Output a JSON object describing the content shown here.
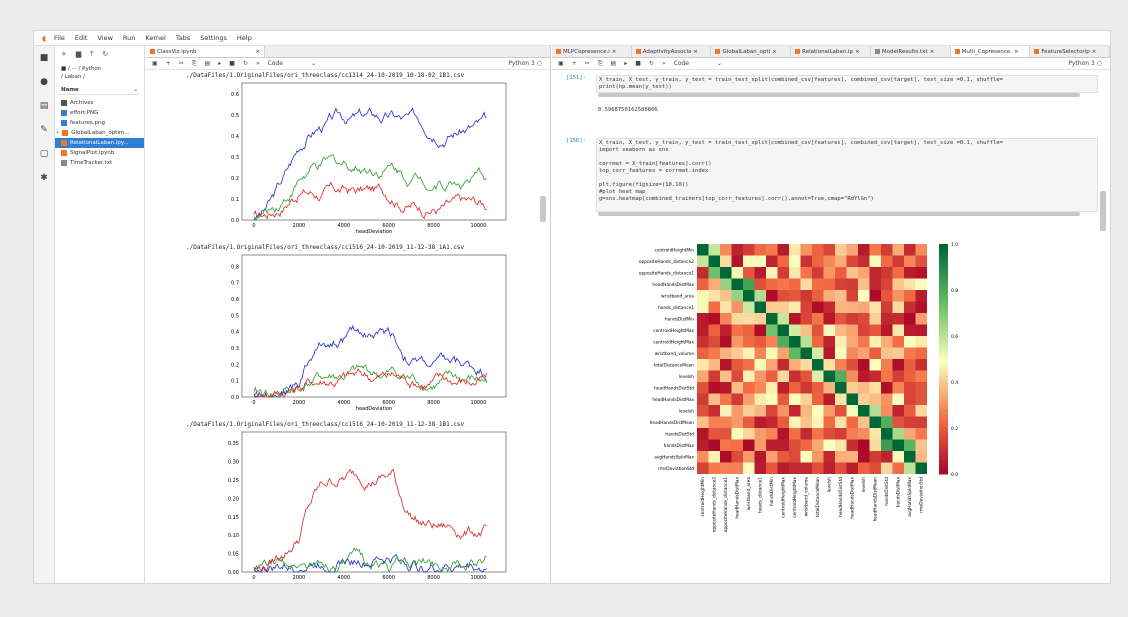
{
  "menu": [
    "File",
    "Edit",
    "View",
    "Run",
    "Kernel",
    "Tabs",
    "Settings",
    "Help"
  ],
  "filebrowser": {
    "path_line1": "■ / ··· / Python",
    "path_line2": "/ Laban /",
    "header_name": "Name",
    "items": [
      {
        "name": "Archives",
        "type": "folder"
      },
      {
        "name": "effort.PNG",
        "type": "image"
      },
      {
        "name": "features.png",
        "type": "image"
      },
      {
        "name": "GlobalLaban_optim...",
        "type": "notebook",
        "running": true
      },
      {
        "name": "RelationalLaban.ipy...",
        "type": "notebook",
        "selected": true
      },
      {
        "name": "SignalPlot.ipynb",
        "type": "notebook"
      },
      {
        "name": "TimeTracker.txt",
        "type": "text"
      }
    ]
  },
  "left_notebook": {
    "tab": "ClassViz.ipynb",
    "celltype": "Code",
    "kernel": "Python 3",
    "plots": [
      {
        "title": "./DataFiles/1.OriginalFiles/ori_threeclass/cc1314_24-10-2019_10-18-02_1B1.csv",
        "xlabel": "headDeviation",
        "yticks": [
          "0.0",
          "0.1",
          "0.2",
          "0.3",
          "0.4",
          "0.5",
          "0.6"
        ],
        "xticks": [
          "0",
          "2000",
          "4000",
          "6000",
          "8000",
          "10000"
        ]
      },
      {
        "title": "./DataFiles/1.OriginalFiles/ori_threeclass/cc1516_24-10-2019_11-12-38_1A1.csv",
        "xlabel": "headDeviation",
        "yticks": [
          "0.0",
          "0.1",
          "0.2",
          "0.3",
          "0.4",
          "0.5",
          "0.6",
          "0.7",
          "0.8"
        ],
        "xticks": [
          "0",
          "2000",
          "4000",
          "6000",
          "8000",
          "10000"
        ]
      },
      {
        "title": "./DataFiles/1.OriginalFiles/ori_threeclass/cc1516_24-10-2019_11-12-38_1B1.csv",
        "xlabel": "",
        "yticks": [
          "0.00",
          "0.05",
          "0.10",
          "0.15",
          "0.20",
          "0.25",
          "0.30",
          "0.35"
        ],
        "xticks": [
          "0",
          "2000",
          "4000",
          "6000",
          "8000",
          "10000"
        ]
      }
    ]
  },
  "right_notebook": {
    "tabs": [
      "MLPCopresence.i",
      "AdaptivityAssocia",
      "GlobalLaban_opti",
      "RelationalLaban.ip",
      "ModelResults.txt",
      "Multi_Copresence.",
      "FeatureSelectorip"
    ],
    "celltype": "Code",
    "kernel": "Python 3",
    "cell1_prompt": "[151]:",
    "cell1_code": "X_train, X_test, y_train, y_test = train_test_split(combined_csv[features], combined_csv[target], test_size =0.1, shuffle=\nprint(np.mean(y_test))",
    "cell1_output": "0.5968750162588866",
    "cell2_prompt": "[156]:",
    "cell2_code": "X_train, X_test, y_train, y_test = train_test_split(combined_csv[features], combined_csv[target], test_size =0.1, shuffle=\nimport seaborn as sns\n\ncorrmat = X_train[features].corr()\ntop_corr_features = corrmat.index\n\nplt.figure(figsize=(10,10))\n#plot heat map\ng=sns.heatmap(combined_trainers[top_corr_features].corr(),annot=True,cmap=\"RdYlGn\")",
    "heatmap_labels": [
      "centroidHeightMin",
      "oppositeHands_distance2",
      "oppositeHands_distance1",
      "headHandsDistMax",
      "wristband_area",
      "heads_distance1",
      "handsDistMin",
      "centroidHeightMax",
      "centroidHeightMax",
      "wristband_volume",
      "totalDistanceMean",
      "levelsh",
      "headHandsDistStd",
      "headHandsDistMax",
      "levelsh",
      "headHandsDistMean",
      "handsDistStd",
      "handsDistMax",
      "avgHandsSpInMax",
      "rmsDeviationStd"
    ],
    "colorbar_ticks": [
      "1.0",
      "0.8",
      "0.6",
      "0.4",
      "0.2",
      "0.0"
    ]
  },
  "colors": {
    "accent": "#f37626",
    "select": "#2f7fd7",
    "series": [
      "#1f2bd0",
      "#2a9d2a",
      "#e0231f"
    ]
  }
}
